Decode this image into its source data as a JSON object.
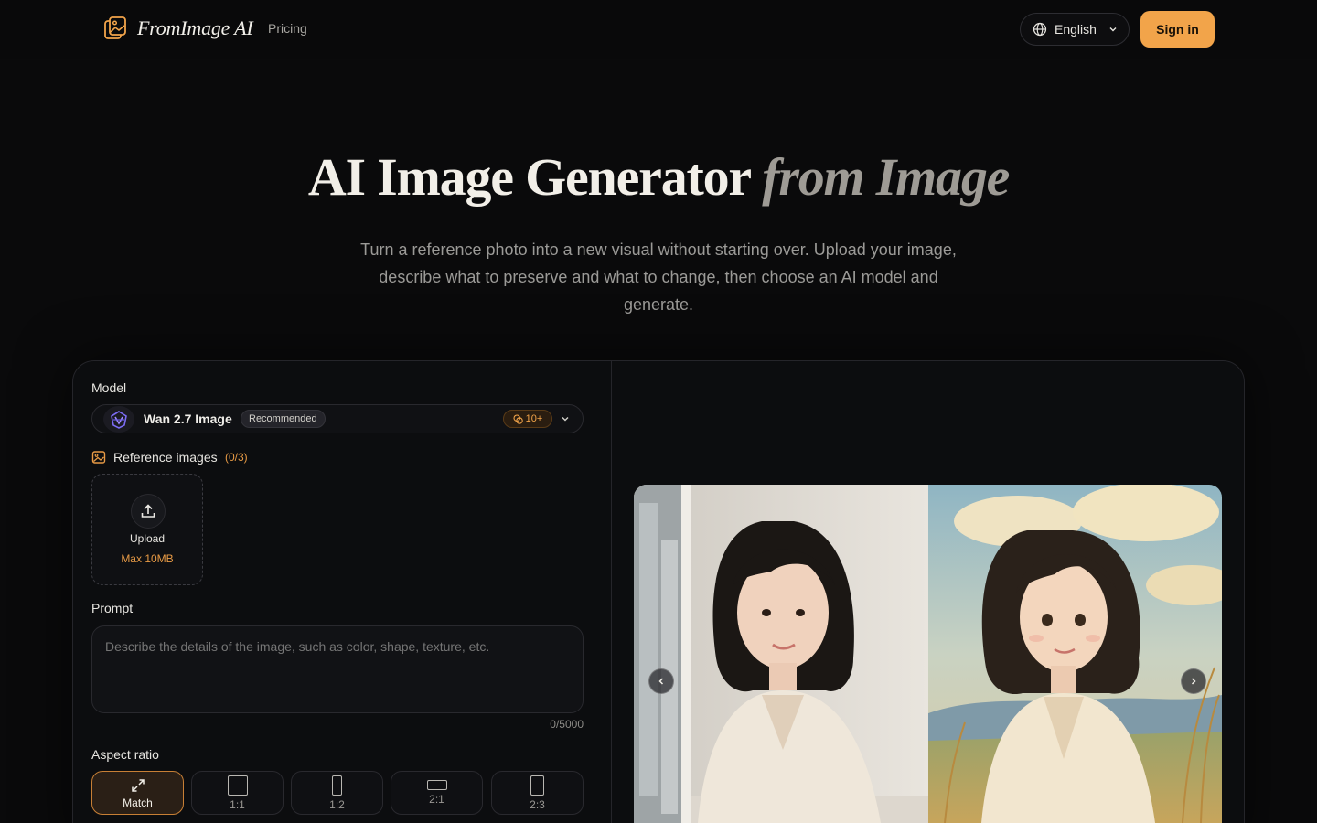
{
  "header": {
    "brand": "FromImage AI",
    "nav_pricing": "Pricing",
    "language": "English",
    "sign_in": "Sign in"
  },
  "hero": {
    "title_main": "AI Image Generator",
    "title_accent": "from Image",
    "subtitle": "Turn a reference photo into a new visual without starting over. Upload your image, describe what to preserve and what to change, then choose an AI model and generate."
  },
  "form": {
    "model_label": "Model",
    "model_name": "Wan 2.7 Image",
    "model_badge": "Recommended",
    "model_credits": "10+",
    "reference_label": "Reference images",
    "reference_count": "(0/3)",
    "upload_label": "Upload",
    "upload_limit": "Max 10MB",
    "prompt_label": "Prompt",
    "prompt_placeholder": "Describe the details of the image, such as color, shape, texture, etc.",
    "prompt_count": "0/5000",
    "aspect_label": "Aspect ratio",
    "aspect_options": [
      {
        "label": "Match",
        "active": true
      },
      {
        "label": "1:1",
        "active": false
      },
      {
        "label": "1:2",
        "active": false
      },
      {
        "label": "2:1",
        "active": false
      },
      {
        "label": "2:3",
        "active": false
      }
    ]
  },
  "colors": {
    "accent": "#f2a44a",
    "background": "#0a0a0b",
    "card": "#0c0d0f",
    "border": "#25252a"
  },
  "icons": {
    "logo": "image-stack-icon",
    "language": "globe-icon",
    "dropdown": "chevron-down-icon",
    "reference": "image-icon",
    "upload": "upload-icon",
    "match": "expand-arrows-icon",
    "carousel_prev": "chevron-left-icon",
    "carousel_next": "chevron-right-icon"
  }
}
